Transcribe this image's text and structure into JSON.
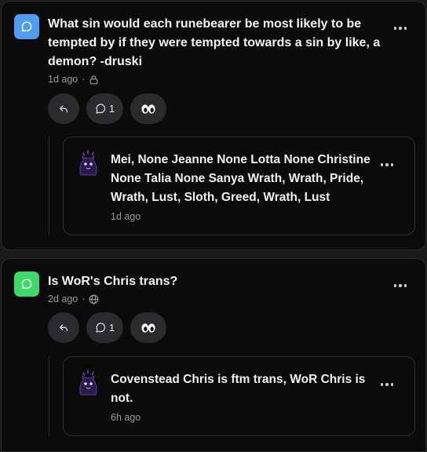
{
  "posts": [
    {
      "question": "What sin would each runebearer be most likely to be tempted by if they were tempted towards a sin by like, a demon? -druski",
      "time": "1d ago",
      "visibility_icon": "lock-icon",
      "reply_count": "1",
      "reply": {
        "text": "Mei, None Jeanne None Lotta None Christine None Talia None Sanya Wrath, Wrath, Pride, Wrath, Lust, Sloth, Greed, Wrath, Lust",
        "time": "1d ago"
      },
      "icon_color": "#4f9cf0"
    },
    {
      "question": "Is WoR's Chris trans?",
      "time": "2d ago",
      "visibility_icon": "globe-icon",
      "reply_count": "1",
      "reply": {
        "text": "Covenstead Chris is ftm trans, WoR Chris is not.",
        "time": "6h ago"
      },
      "icon_color": "#3fd86a"
    }
  ],
  "meta_separator": "·",
  "colors": {
    "card_bg": "#0b0b0c",
    "pill_bg": "#2b2b2e",
    "page_bg": "#1a1a1d"
  }
}
